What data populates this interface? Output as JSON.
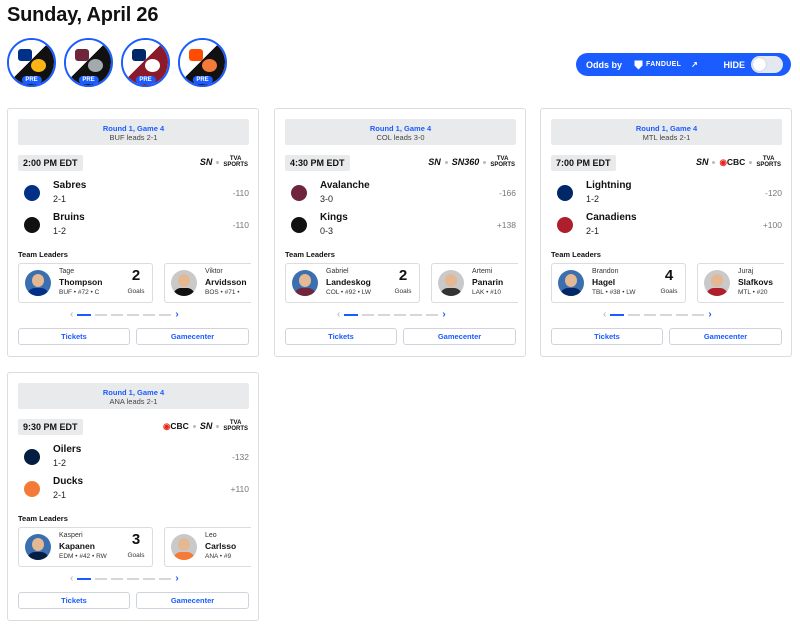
{
  "date_title": "Sunday, April 26",
  "quick_games": [
    {
      "badge": "PRE",
      "away_color": "#003087",
      "home_color": "#fcb514"
    },
    {
      "badge": "PRE",
      "away_color": "#6f263d",
      "home_color": "#a2aaad"
    },
    {
      "badge": "PRE",
      "away_color": "#002868",
      "home_color": "#af1e2d"
    },
    {
      "badge": "PRE",
      "away_color": "#ff4c00",
      "home_color": "#f47a38"
    }
  ],
  "odds": {
    "by_label": "Odds by",
    "provider": "FANDUEL",
    "hide_label": "HIDE",
    "hide_on": false
  },
  "games": [
    {
      "round": "Round 1, Game 4",
      "series_status": "BUF leads 2-1",
      "time": "2:00 PM EDT",
      "broadcasts": [
        "SN",
        "TVA SPORTS"
      ],
      "teams": [
        {
          "name": "Sabres",
          "record": "2-1",
          "odds": "-110",
          "color": "#003087"
        },
        {
          "name": "Bruins",
          "record": "1-2",
          "odds": "-110",
          "color": "#111111"
        }
      ],
      "team_leaders_label": "Team Leaders",
      "leaders": [
        {
          "first": "Tage",
          "last": "Thompson",
          "info": "BUF • #72 • C",
          "stat": "2",
          "stat_label": "Goals",
          "color": "#003087"
        },
        {
          "first": "Viktor",
          "last": "Arvidsson",
          "info": "BOS • #71 •",
          "stat": "",
          "stat_label": "",
          "color": "#111111"
        }
      ],
      "tickets_label": "Tickets",
      "gamecenter_label": "Gamecenter"
    },
    {
      "round": "Round 1, Game 4",
      "series_status": "COL leads 3-0",
      "time": "4:30 PM EDT",
      "broadcasts": [
        "SN",
        "SN360",
        "TVA SPORTS"
      ],
      "teams": [
        {
          "name": "Avalanche",
          "record": "3-0",
          "odds": "-166",
          "color": "#6f263d"
        },
        {
          "name": "Kings",
          "record": "0-3",
          "odds": "+138",
          "color": "#111111"
        }
      ],
      "team_leaders_label": "Team Leaders",
      "leaders": [
        {
          "first": "Gabriel",
          "last": "Landeskog",
          "info": "COL • #92 • LW",
          "stat": "2",
          "stat_label": "Goals",
          "color": "#6f263d"
        },
        {
          "first": "Artemi",
          "last": "Panarin",
          "info": "LAK • #10",
          "stat": "",
          "stat_label": "",
          "color": "#333333"
        }
      ],
      "tickets_label": "Tickets",
      "gamecenter_label": "Gamecenter"
    },
    {
      "round": "Round 1, Game 4",
      "series_status": "MTL leads 2-1",
      "time": "7:00 PM EDT",
      "broadcasts": [
        "SN",
        "CBC",
        "TVA SPORTS"
      ],
      "teams": [
        {
          "name": "Lightning",
          "record": "1-2",
          "odds": "-120",
          "color": "#002868"
        },
        {
          "name": "Canadiens",
          "record": "2-1",
          "odds": "+100",
          "color": "#af1e2d"
        }
      ],
      "team_leaders_label": "Team Leaders",
      "leaders": [
        {
          "first": "Brandon",
          "last": "Hagel",
          "info": "TBL • #38 • LW",
          "stat": "4",
          "stat_label": "Goals",
          "color": "#002868"
        },
        {
          "first": "Juraj",
          "last": "Slafkovs",
          "info": "MTL • #20",
          "stat": "",
          "stat_label": "",
          "color": "#af1e2d"
        }
      ],
      "tickets_label": "Tickets",
      "gamecenter_label": "Gamecenter"
    },
    {
      "round": "Round 1, Game 4",
      "series_status": "ANA leads 2-1",
      "time": "9:30 PM EDT",
      "broadcasts": [
        "CBC",
        "SN",
        "TVA SPORTS"
      ],
      "teams": [
        {
          "name": "Oilers",
          "record": "1-2",
          "odds": "-132",
          "color": "#041e42"
        },
        {
          "name": "Ducks",
          "record": "2-1",
          "odds": "+110",
          "color": "#f47a38"
        }
      ],
      "team_leaders_label": "Team Leaders",
      "leaders": [
        {
          "first": "Kasperi",
          "last": "Kapanen",
          "info": "EDM • #42 • RW",
          "stat": "3",
          "stat_label": "Goals",
          "color": "#041e42"
        },
        {
          "first": "Leo",
          "last": "Carlsso",
          "info": "ANA • #9",
          "stat": "",
          "stat_label": "",
          "color": "#f47a38"
        }
      ],
      "tickets_label": "Tickets",
      "gamecenter_label": "Gamecenter"
    }
  ]
}
